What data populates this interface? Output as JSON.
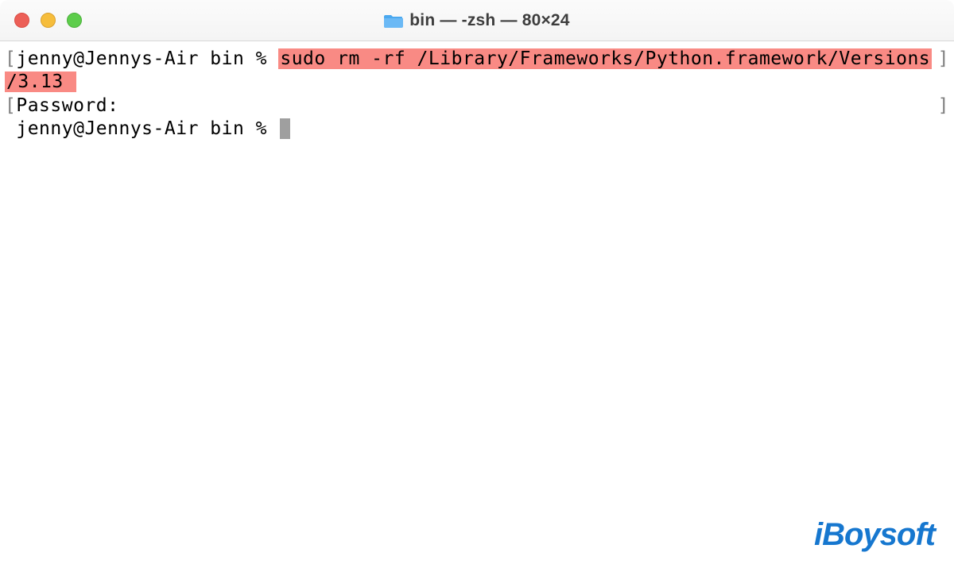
{
  "window": {
    "title": "bin — -zsh — 80×24"
  },
  "terminal": {
    "line1_prompt": "jenny@Jennys-Air bin % ",
    "line1_cmd_part1": "sudo rm -rf /Library/Frameworks/Python.framework/Versions",
    "line2_cmd_part2": "/3.13 ",
    "line3_password": "Password:",
    "line4_prompt": "jenny@Jennys-Air bin % ",
    "left_bracket": "[",
    "right_bracket": "]"
  },
  "watermark": {
    "text": "iBoysoft"
  }
}
